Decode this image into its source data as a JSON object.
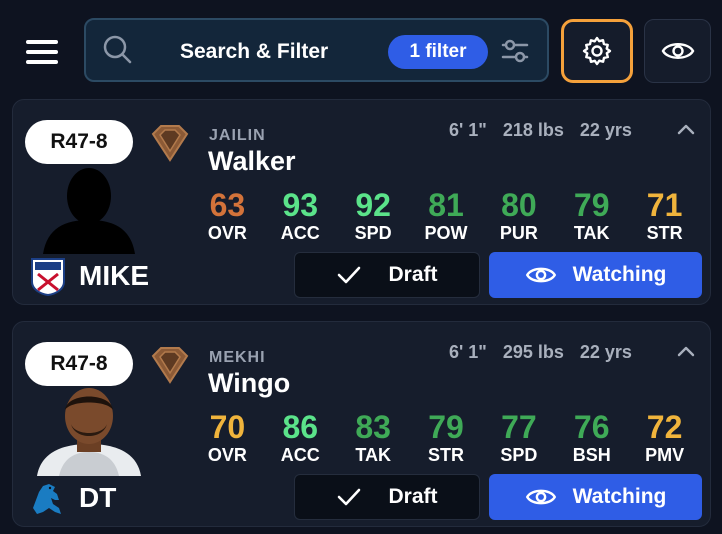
{
  "search": {
    "label": "Search & Filter",
    "filter_badge": "1 filter"
  },
  "colors": {
    "accent": "#2f5de6",
    "settings_outline": "#f5a13b",
    "stat_orange_dark": "#d3733a",
    "stat_green_bright": "#5be38a",
    "stat_green": "#3faa57",
    "stat_yellow": "#f0b43c"
  },
  "players": [
    {
      "round_pick": "R47-8",
      "first_name": "JAILIN",
      "last_name": "Walker",
      "height": "6' 1\"",
      "weight": "218 lbs",
      "age": "22 yrs",
      "position": "MIKE",
      "team_icon": "nfl-shield-icon",
      "stats": [
        {
          "value": "63",
          "label": "OVR",
          "color": "#d3733a"
        },
        {
          "value": "93",
          "label": "ACC",
          "color": "#5be38a"
        },
        {
          "value": "92",
          "label": "SPD",
          "color": "#5be38a"
        },
        {
          "value": "81",
          "label": "POW",
          "color": "#3faa57"
        },
        {
          "value": "80",
          "label": "PUR",
          "color": "#3faa57"
        },
        {
          "value": "79",
          "label": "TAK",
          "color": "#3faa57"
        },
        {
          "value": "71",
          "label": "STR",
          "color": "#f0b43c"
        }
      ],
      "draft_label": "Draft",
      "watch_label": "Watching"
    },
    {
      "round_pick": "R47-8",
      "first_name": "MEKHI",
      "last_name": "Wingo",
      "height": "6' 1\"",
      "weight": "295 lbs",
      "age": "22 yrs",
      "position": "DT",
      "team_icon": "lions-logo-icon",
      "stats": [
        {
          "value": "70",
          "label": "OVR",
          "color": "#f0b43c"
        },
        {
          "value": "86",
          "label": "ACC",
          "color": "#5be38a"
        },
        {
          "value": "83",
          "label": "TAK",
          "color": "#3faa57"
        },
        {
          "value": "79",
          "label": "STR",
          "color": "#3faa57"
        },
        {
          "value": "77",
          "label": "SPD",
          "color": "#3faa57"
        },
        {
          "value": "76",
          "label": "BSH",
          "color": "#3faa57"
        },
        {
          "value": "72",
          "label": "PMV",
          "color": "#f0b43c"
        }
      ],
      "draft_label": "Draft",
      "watch_label": "Watching"
    }
  ]
}
